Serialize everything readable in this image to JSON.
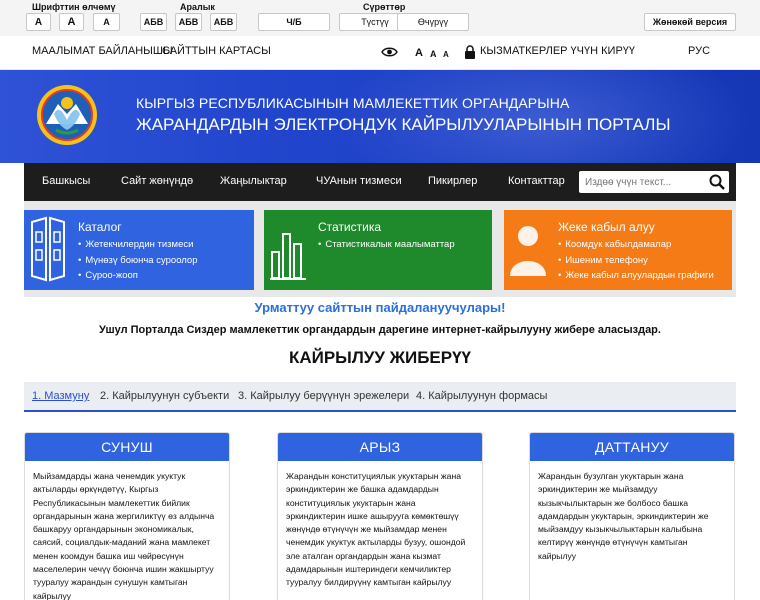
{
  "accessibility": {
    "font_size_label": "Шрифттин өлчөмү",
    "font_size_buttons": [
      "А",
      "А",
      "А"
    ],
    "spacing_label": "Аралык",
    "spacing_buttons": [
      "АБВ",
      "АБВ",
      "АБВ"
    ],
    "bw_button": "Ч/Б",
    "images_label": "Сүрөттөр",
    "images_on": "Түстүү",
    "images_off": "Өчүрүү",
    "simple_version": "Жөнөкөй версия"
  },
  "topnav": {
    "contacts": "Маалымат байланышы",
    "sitemap": "Сайттын картасы",
    "font_a": [
      "A",
      "A",
      "A"
    ],
    "staff_login": "Кызматкерлер үчүн кирүү",
    "language": "РУС"
  },
  "banner": {
    "line1": "Кыргыз Республикасынын мамлекеттик органдарына",
    "line2": "Жарандардын электрондук кайрылууларынын порталы"
  },
  "menu": {
    "items": [
      "Башкысы",
      "Сайт жөнүндө",
      "Жаңылыктар",
      "ЧУАнын тизмеси",
      "Пикирлер",
      "Контакттар"
    ],
    "search_placeholder": "Издөө үчүн текст..."
  },
  "cards": [
    {
      "title": "Каталог",
      "items": [
        "Жетекчилердин тизмеси",
        "Мүнөзү боюнча суроолор",
        "Суроо-жооп"
      ],
      "color": "#2f63e0"
    },
    {
      "title": "Статистика",
      "items": [
        "Статистикалык маалыматтар"
      ],
      "color": "#1f8a2c"
    },
    {
      "title": "Жеке кабыл алуу",
      "items": [
        "Коомдук кабылдамалар",
        "Ишеним телефону",
        "Жеке кабыл алуулардын графиги"
      ],
      "color": "#f47b16"
    }
  ],
  "welcome": {
    "title": "Урматтуу сайттын пайдалануучулары!",
    "text": "Ушул Порталда Сиздер мамлекеттик органдардын дарегине интернет-кайрылууну жибере аласыздар."
  },
  "section_title": "КАЙРЫЛУУ ЖИБЕРҮҮ",
  "steps": [
    "1. Мазмуну",
    "2. Кайрылуунун субъекти",
    "3. Кайрылуу берүүнүн эрежелери",
    "4. Кайрылуунун формасы"
  ],
  "appeal_types": [
    {
      "title": "СУНУШ",
      "text": "Мыйзамдарды жана ченемдик укуктук актыларды өркүндөтүү, Кыргыз Республикасынын мамлекеттик бийлик органдарынын жана жергиликтүү өз алдынча башкаруу органдарынын экономикалык, саясий, социалдык-маданий жана мамлекет менен коомдун башка иш чөйрөсүнүн маселелерин чечүү боюнча ишин жакшыртуу тууралуу жарандын сунушун камтыган кайрылуу"
    },
    {
      "title": "АРЫЗ",
      "text": "Жарандын конституциялык укуктарын жана эркиндиктерин же башка адамдардын конституциялык укуктарын жана эркиндиктерин ишке ашырууга көмөктөшүү жөнүндө өтүнүчүн же мыйзамдар менен ченемдик укуктук актыларды бузуу, ошондой эле аталган органдардын жана кызмат адамдарынын иштериндеги кемчиликтер тууралуу билдирүүнү камтыган кайрылуу"
    },
    {
      "title": "ДАТТАНУУ",
      "text": "Жарандын бузулган укуктарын жана эркиндиктерин же мыйзамдуу кызыкчылыктарын же болбосо башка адамдардын укуктарын, эркиндиктерин же мыйзамдуу кызыкчылыктарын калыбына келтирүү жөнүндө өтүнүчүн камтыган кайрылуу"
    }
  ]
}
